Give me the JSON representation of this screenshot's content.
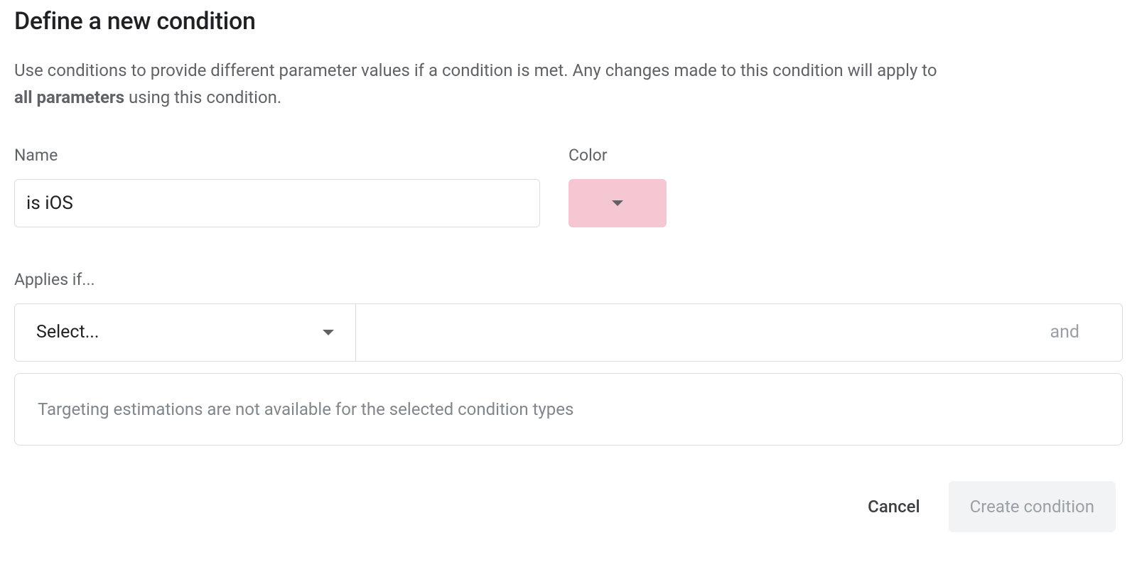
{
  "title": "Define a new condition",
  "description": {
    "pre": "Use conditions to provide different parameter values if a condition is met. Any changes made to this condition will apply to ",
    "bold": "all parameters",
    "post": " using this condition."
  },
  "fields": {
    "name_label": "Name",
    "name_value": "is iOS",
    "color_label": "Color",
    "selected_color": "#f4c7d3"
  },
  "applies": {
    "label": "Applies if...",
    "select_placeholder": "Select...",
    "and_label": "and"
  },
  "estimation": {
    "message": "Targeting estimations are not available for the selected condition types"
  },
  "footer": {
    "cancel_label": "Cancel",
    "create_label": "Create condition"
  }
}
